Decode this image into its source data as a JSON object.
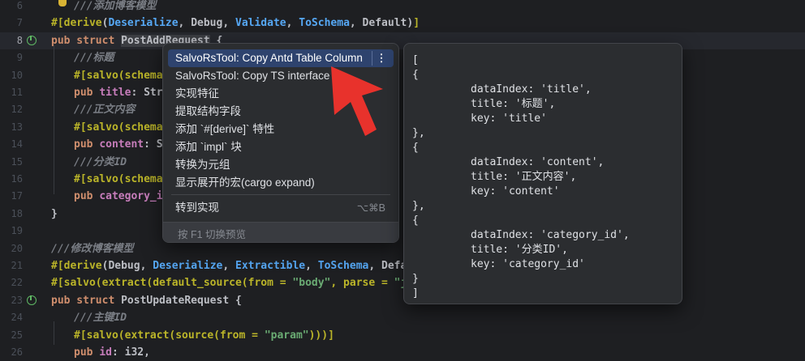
{
  "editor": {
    "lines": [
      {
        "num": "6",
        "parts": [
          {
            "c": "t-com",
            "t": "///添加博客模型"
          }
        ],
        "indent": 1
      },
      {
        "num": "7",
        "parts": [
          {
            "c": "t-attr",
            "t": "#["
          },
          {
            "c": "t-attr",
            "t": "derive"
          },
          {
            "c": "t-type",
            "t": "("
          },
          {
            "c": "t-hl",
            "t": "Deserialize"
          },
          {
            "c": "t-type",
            "t": ", Debug, "
          },
          {
            "c": "t-hl",
            "t": "Validate"
          },
          {
            "c": "t-type",
            "t": ", "
          },
          {
            "c": "t-hl",
            "t": "ToSchema"
          },
          {
            "c": "t-type",
            "t": ", Default)"
          },
          {
            "c": "t-attr",
            "t": "]"
          }
        ],
        "indent": 0
      },
      {
        "num": "8",
        "parts": [
          {
            "c": "t-kw",
            "t": "pub struct "
          },
          {
            "c": "t-struct-bg",
            "t": "PostAddRequest"
          },
          {
            "c": "t-type",
            "t": " {"
          }
        ],
        "indent": 0,
        "current": true,
        "icon": true
      },
      {
        "num": "9",
        "parts": [
          {
            "c": "t-com",
            "t": "///标题"
          }
        ],
        "indent": 1
      },
      {
        "num": "10",
        "parts": [
          {
            "c": "t-attr",
            "t": "#[salvo(schema("
          }
        ],
        "indent": 1
      },
      {
        "num": "11",
        "parts": [
          {
            "c": "t-kw",
            "t": "pub "
          },
          {
            "c": "t-field",
            "t": "title"
          },
          {
            "c": "t-type",
            "t": ": Stri"
          }
        ],
        "indent": 1
      },
      {
        "num": "12",
        "parts": [
          {
            "c": "t-com",
            "t": "///正文内容"
          }
        ],
        "indent": 1
      },
      {
        "num": "13",
        "parts": [
          {
            "c": "t-attr",
            "t": "#[salvo(schema("
          }
        ],
        "indent": 1
      },
      {
        "num": "14",
        "parts": [
          {
            "c": "t-kw",
            "t": "pub "
          },
          {
            "c": "t-field",
            "t": "content"
          },
          {
            "c": "t-type",
            "t": ": St"
          }
        ],
        "indent": 1
      },
      {
        "num": "15",
        "parts": [
          {
            "c": "t-com",
            "t": "///分类ID"
          }
        ],
        "indent": 1
      },
      {
        "num": "16",
        "parts": [
          {
            "c": "t-attr",
            "t": "#[salvo(schema("
          }
        ],
        "indent": 1
      },
      {
        "num": "17",
        "parts": [
          {
            "c": "t-kw",
            "t": "pub "
          },
          {
            "c": "t-field",
            "t": "category_id"
          }
        ],
        "indent": 1
      },
      {
        "num": "18",
        "parts": [
          {
            "c": "t-type",
            "t": "}"
          }
        ],
        "indent": 0
      },
      {
        "num": "19",
        "parts": [],
        "indent": 0
      },
      {
        "num": "20",
        "parts": [
          {
            "c": "t-com",
            "t": "///修改博客模型"
          }
        ],
        "indent": 0
      },
      {
        "num": "21",
        "parts": [
          {
            "c": "t-attr",
            "t": "#["
          },
          {
            "c": "t-attr",
            "t": "derive"
          },
          {
            "c": "t-type",
            "t": "(Debug, "
          },
          {
            "c": "t-hl",
            "t": "Deserialize"
          },
          {
            "c": "t-type",
            "t": ", "
          },
          {
            "c": "t-hl",
            "t": "Extractible"
          },
          {
            "c": "t-type",
            "t": ", "
          },
          {
            "c": "t-hl",
            "t": "ToSchema"
          },
          {
            "c": "t-type",
            "t": ", Default)"
          }
        ],
        "indent": 0
      },
      {
        "num": "22",
        "parts": [
          {
            "c": "t-attr",
            "t": "#[salvo(extract(default_source(from = "
          },
          {
            "c": "t-str",
            "t": "\"body\""
          },
          {
            "c": "t-attr",
            "t": ", parse = "
          },
          {
            "c": "t-str",
            "t": "\"json\""
          }
        ],
        "indent": 0
      },
      {
        "num": "23",
        "parts": [
          {
            "c": "t-kw",
            "t": "pub struct "
          },
          {
            "c": "t-type",
            "t": "PostUpdateRequest {"
          }
        ],
        "indent": 0,
        "icon": true
      },
      {
        "num": "24",
        "parts": [
          {
            "c": "t-com",
            "t": "///主键ID"
          }
        ],
        "indent": 1
      },
      {
        "num": "25",
        "parts": [
          {
            "c": "t-attr",
            "t": "#[salvo(extract(source(from = "
          },
          {
            "c": "t-str",
            "t": "\"param\""
          },
          {
            "c": "t-attr",
            "t": ")))]"
          }
        ],
        "indent": 1
      },
      {
        "num": "26",
        "parts": [
          {
            "c": "t-kw",
            "t": "pub "
          },
          {
            "c": "t-field",
            "t": "id"
          },
          {
            "c": "t-type",
            "t": ": i32,"
          }
        ],
        "indent": 1
      }
    ]
  },
  "menu": {
    "items": [
      {
        "label": "SalvoRsTool: Copy Antd Table Column",
        "selected": true
      },
      {
        "label": "SalvoRsTool: Copy TS interface"
      },
      {
        "label": "实现特征"
      },
      {
        "label": "提取结构字段"
      },
      {
        "label": "添加 `#[derive]` 特性"
      },
      {
        "label": "添加 `impl` 块"
      },
      {
        "label": "转换为元组"
      },
      {
        "label": "显示展开的宏(cargo expand)"
      }
    ],
    "more_icon": "⋮",
    "goto": {
      "label": "转到实现",
      "shortcut": "⌥⌘B"
    },
    "footer": "按 F1 切换预览"
  },
  "preview": {
    "lines": [
      {
        "t": "[",
        "ind": false
      },
      {
        "t": "{",
        "ind": false
      },
      {
        "t": "dataIndex: 'title',",
        "ind": true
      },
      {
        "t": "title: '标题',",
        "ind": true
      },
      {
        "t": "key: 'title'",
        "ind": true
      },
      {
        "t": "},",
        "ind": false
      },
      {
        "t": "{",
        "ind": false
      },
      {
        "t": "dataIndex: 'content',",
        "ind": true
      },
      {
        "t": "title: '正文内容',",
        "ind": true
      },
      {
        "t": "key: 'content'",
        "ind": true
      },
      {
        "t": "},",
        "ind": false
      },
      {
        "t": "{",
        "ind": false
      },
      {
        "t": "dataIndex: 'category_id',",
        "ind": true
      },
      {
        "t": "title: '分类ID',",
        "ind": true
      },
      {
        "t": "key: 'category_id'",
        "ind": true
      },
      {
        "t": "}",
        "ind": false
      },
      {
        "t": "]",
        "ind": false
      }
    ]
  },
  "colors": {
    "arrow": "#e8322c",
    "selection": "#2e436e"
  }
}
